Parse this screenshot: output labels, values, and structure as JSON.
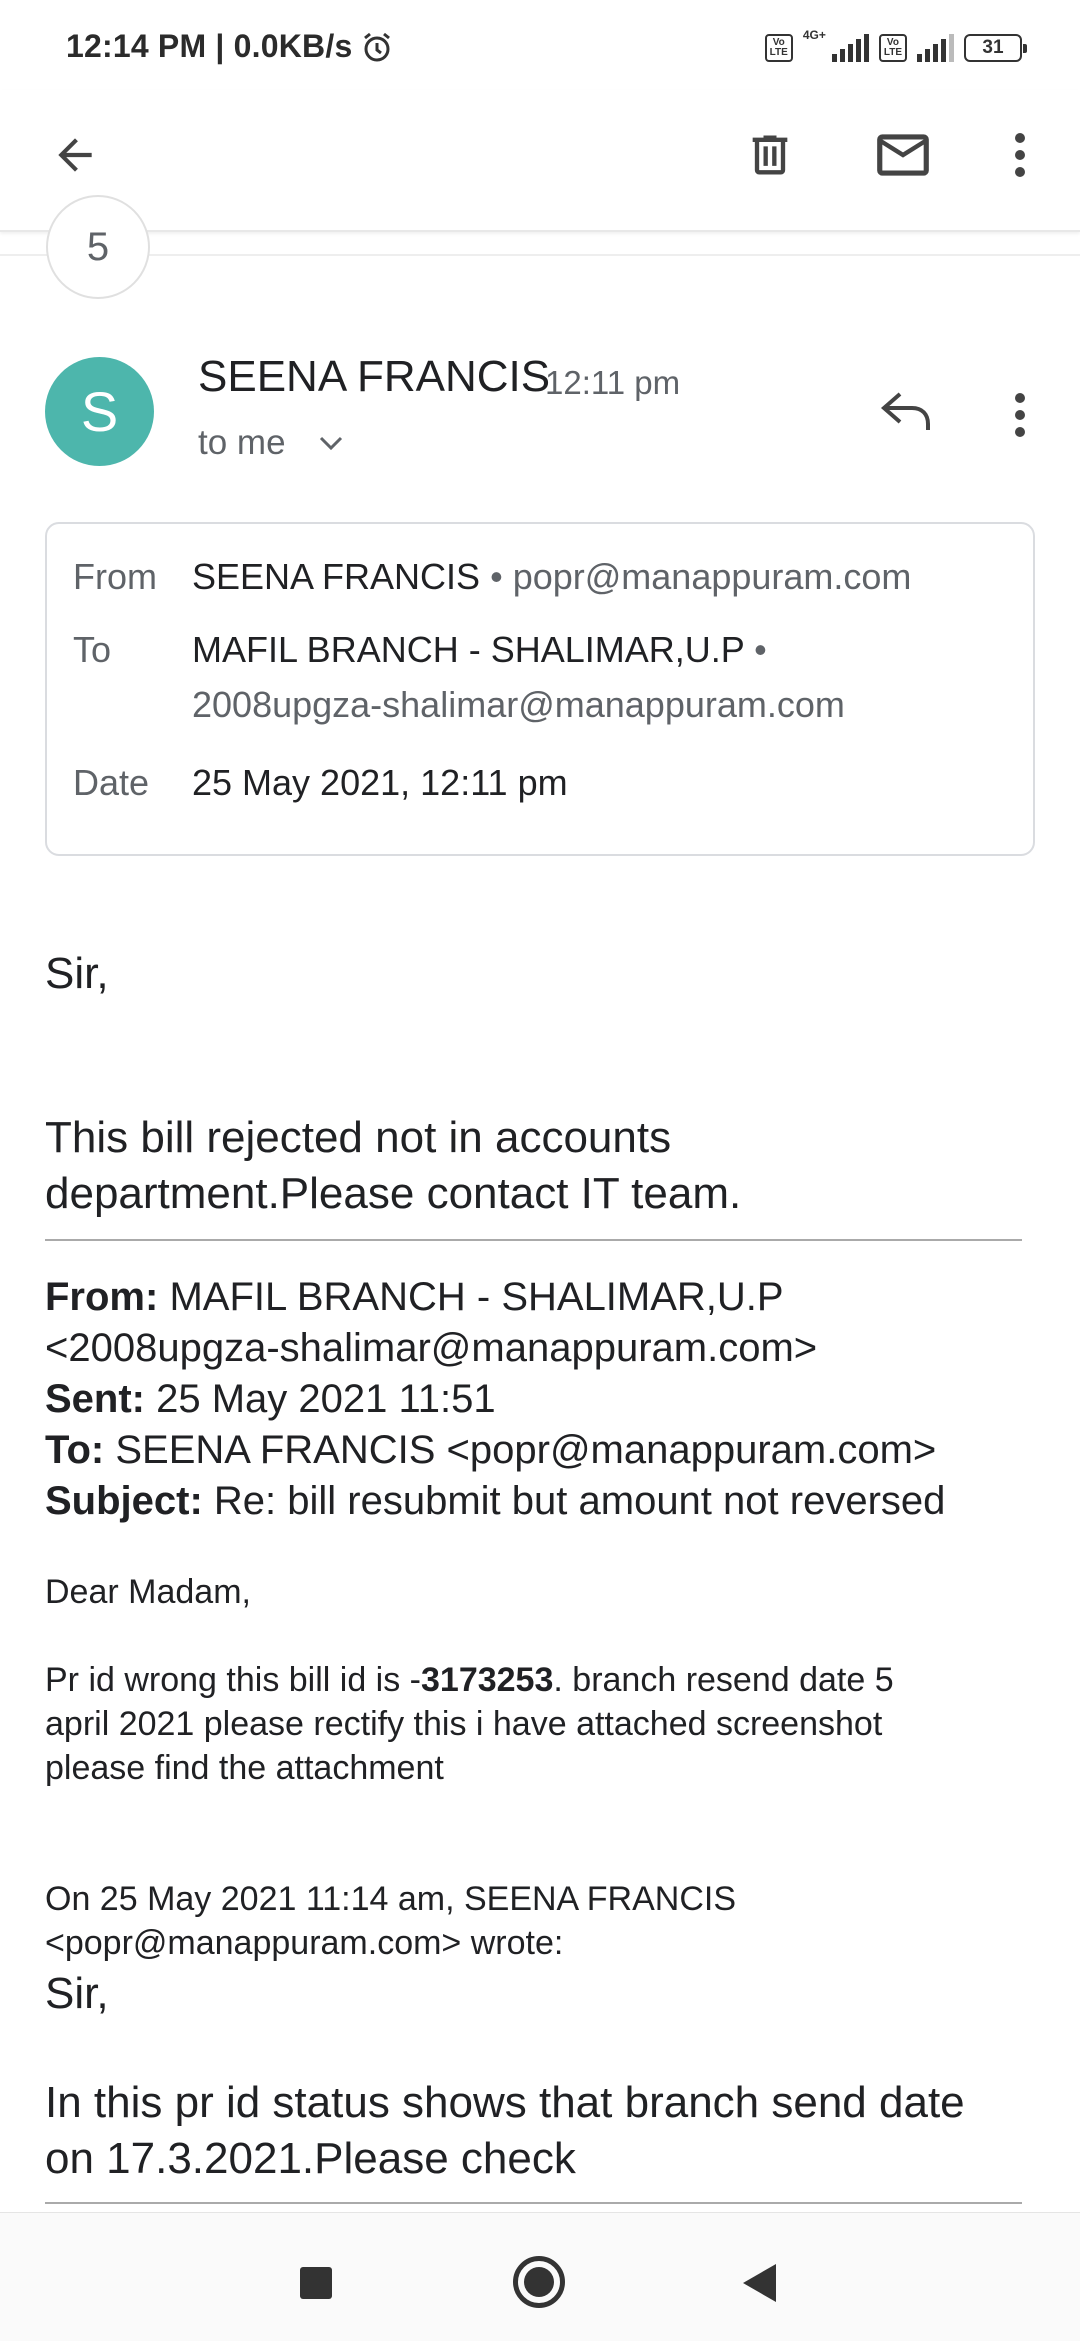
{
  "status_bar": {
    "time_speed": "12:14 PM | 0.0KB/s",
    "network_type": "4G+",
    "volte_label": "Vo LTE",
    "battery": "31"
  },
  "app_bar": {
    "icons": [
      "back-arrow-icon",
      "trash-icon",
      "mail-icon",
      "more-vert-icon"
    ]
  },
  "thread": {
    "collapsed_count": "5"
  },
  "message": {
    "avatar_letter": "S",
    "avatar_color": "#4db6ac",
    "sender_name": "SEENA FRANCIS",
    "time": "12:11 pm",
    "to_me": "to me",
    "details": {
      "from_label": "From",
      "from_name": "SEENA FRANCIS",
      "from_email": "• popr@manappuram.com",
      "to_label": "To",
      "to_name": "MAFIL BRANCH - SHALIMAR,U.P",
      "to_bullet": "•",
      "to_email": "2008upgza-shalimar@manappuram.com",
      "date_label": "Date",
      "date_value": "25 May 2021, 12:11 pm"
    },
    "body": {
      "greeting": "Sir,",
      "line1": "This bill rejected not in accounts",
      "line2": "department.Please contact IT team."
    },
    "quoted_header": {
      "from_label": "From:",
      "from_value": " MAFIL BRANCH - SHALIMAR,U.P",
      "from_email": "<2008upgza-shalimar@manappuram.com>",
      "sent_label": "Sent:",
      "sent_value": " 25 May 2021 11:51",
      "to_label": "To:",
      "to_value": " SEENA FRANCIS <popr@manappuram.com>",
      "subject_label": "Subject:",
      "subject_value": " Re: bill resubmit but amount not reversed"
    },
    "reply": {
      "greeting": "Dear Madam,",
      "line1_pre": "Pr id wrong this bill id is -",
      "line1_bold": "3173253",
      "line1_post": ". branch resend date 5",
      "line2": "april 2021 please rectify this i have attached screenshot",
      "line3": "please find the attachment"
    },
    "quote": {
      "attrib1": "On 25 May 2021 11:14 am, SEENA FRANCIS",
      "attrib2": "<popr@manappuram.com> wrote:",
      "greeting": "Sir,",
      "line1": "In this pr id status shows that branch send date",
      "line2": "on 17.3.2021.Please check"
    }
  },
  "nav_bar": {
    "icons": [
      "recents-square-icon",
      "home-circle-icon",
      "back-triangle-icon"
    ]
  }
}
